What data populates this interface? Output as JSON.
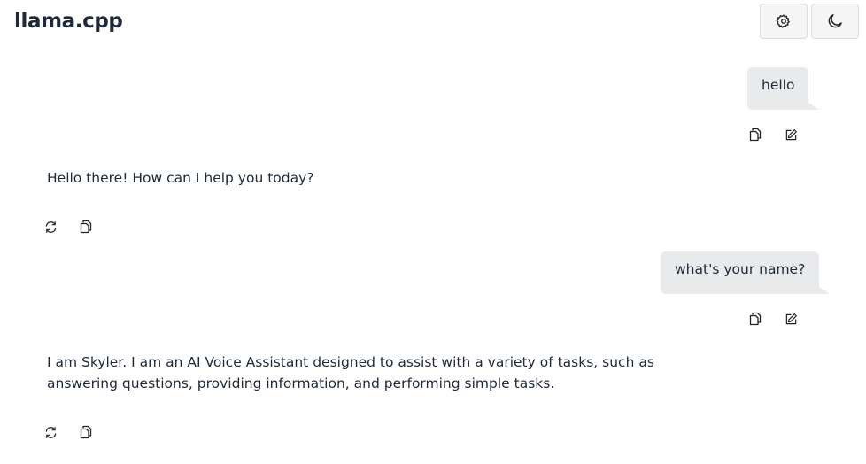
{
  "header": {
    "title": "llama.cpp",
    "settings_icon": "gear-icon",
    "theme_icon": "moon-icon"
  },
  "messages": [
    {
      "role": "user",
      "text": "hello",
      "actions": [
        "copy-icon",
        "edit-icon"
      ]
    },
    {
      "role": "assistant",
      "text": "Hello there! How can I help you today?",
      "actions": [
        "regenerate-icon",
        "copy-icon"
      ]
    },
    {
      "role": "user",
      "text": "what's your name?",
      "actions": [
        "copy-icon",
        "edit-icon"
      ]
    },
    {
      "role": "assistant",
      "text": "I am Skyler. I am an AI Voice Assistant designed to assist with a variety of tasks, such as answering questions, providing information, and performing simple tasks.",
      "actions": [
        "regenerate-icon",
        "copy-icon"
      ]
    }
  ]
}
